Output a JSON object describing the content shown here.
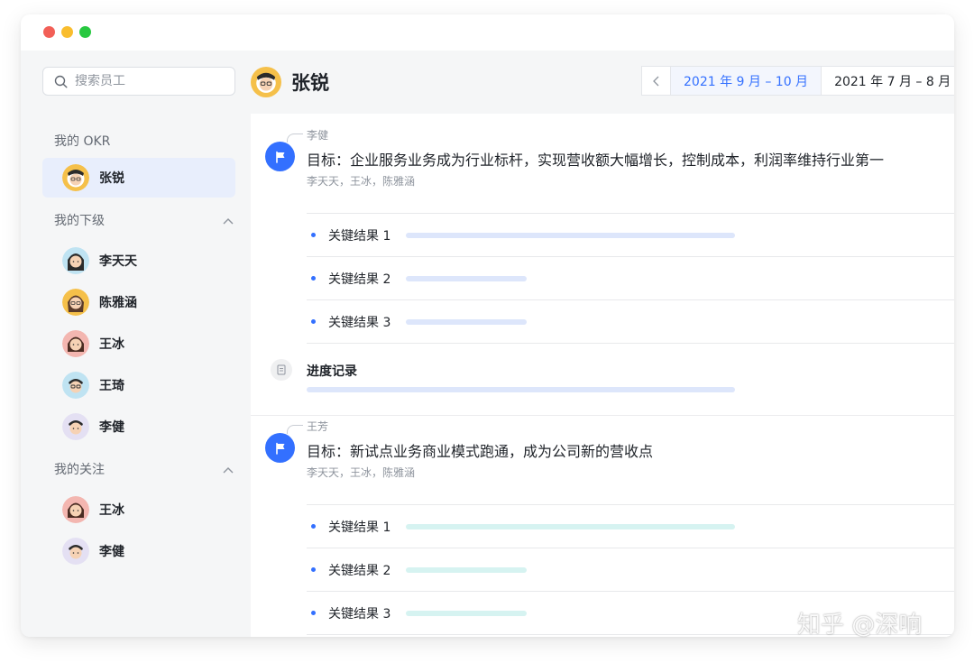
{
  "window": {
    "traffic_lights": [
      "close",
      "minimize",
      "zoom"
    ]
  },
  "sidebar": {
    "search": {
      "placeholder": "搜索员工",
      "icon": "search-icon"
    },
    "my_okr": {
      "label": "我的 OKR",
      "person": {
        "name": "张锐",
        "active": true
      }
    },
    "subordinates": {
      "label": "我的下级",
      "expanded": true,
      "people": [
        {
          "name": "李天天"
        },
        {
          "name": "陈雅涵"
        },
        {
          "name": "王冰"
        },
        {
          "name": "王琦"
        },
        {
          "name": "李健"
        }
      ]
    },
    "following": {
      "label": "我的关注",
      "expanded": true,
      "people": [
        {
          "name": "王冰"
        },
        {
          "name": "李健"
        }
      ]
    }
  },
  "header": {
    "title": "张锐",
    "date_tabs": [
      {
        "label": "2021 年 9 月 – 10 月",
        "active": true
      },
      {
        "label": "2021 年 7 月 – 8 月",
        "active": false
      }
    ]
  },
  "objectives": [
    {
      "parent_owner": "李健",
      "title": "目标：企业服务业务成为行业标杆，实现营收额大幅增长，控制成本，利润率维持行业第一",
      "collaborators": "李天天，王冰，陈雅涵",
      "key_results": [
        {
          "label": "关键结果 1",
          "progress": 0.87
        },
        {
          "label": "关键结果 2",
          "progress": 0.32
        },
        {
          "label": "关键结果 3",
          "progress": 0.32
        }
      ],
      "progress_record": {
        "label": "进度记录"
      }
    },
    {
      "parent_owner": "王芳",
      "title": "目标：新试点业务商业模式跑通，成为公司新的营收点",
      "collaborators": "李天天，王冰，陈雅涵",
      "key_results": [
        {
          "label": "关键结果 1",
          "progress": 0.87
        },
        {
          "label": "关键结果 2",
          "progress": 0.32
        },
        {
          "label": "关键结果 3",
          "progress": 0.32
        }
      ]
    }
  ],
  "colors": {
    "accent": "#3370ff",
    "bar_blue": "#dde6fb",
    "bar_teal": "#d6f3f1",
    "active_item_bg": "#e8eefc"
  },
  "watermark": "知乎 @深响"
}
